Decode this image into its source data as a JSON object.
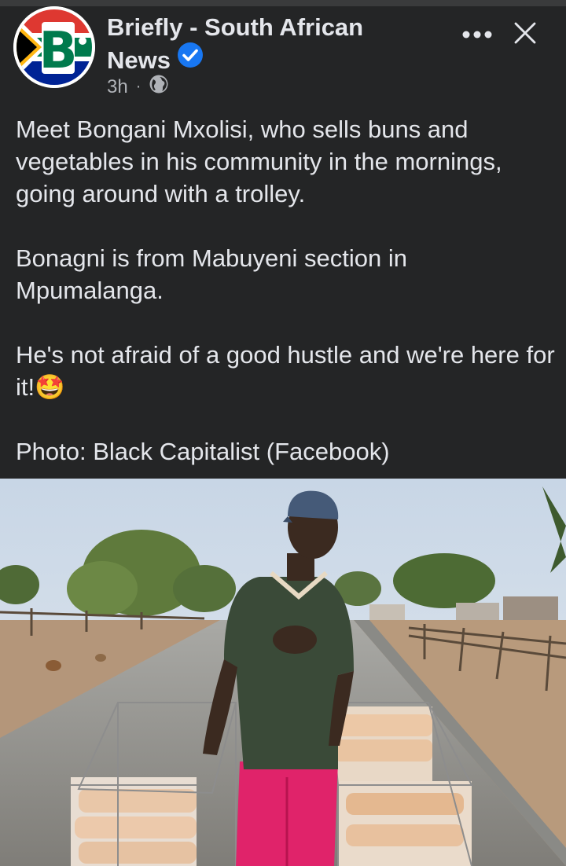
{
  "post": {
    "page_name": "Briefly - South African News",
    "time": "3h",
    "separator": "·",
    "audience_icon": "globe-icon",
    "verified_icon": "verified-badge-icon",
    "logo_letter": "B",
    "caption": {
      "p1": "Meet Bongani Mxolisi, who sells buns and vegetables in his community in the mornings, going around with a trolley.",
      "p2": "Bonagni is from Mabuyeni section in Mpumalanga.",
      "p3": "He's not afraid of a good hustle and we're here for it!",
      "p3_emoji": "🤩",
      "p4": "Photo: Black Capitalist (Facebook)"
    }
  },
  "colors": {
    "background": "#242526",
    "text": "#e4e6eb",
    "secondary_text": "#b0b3b8",
    "verified_blue": "#1877f2"
  }
}
